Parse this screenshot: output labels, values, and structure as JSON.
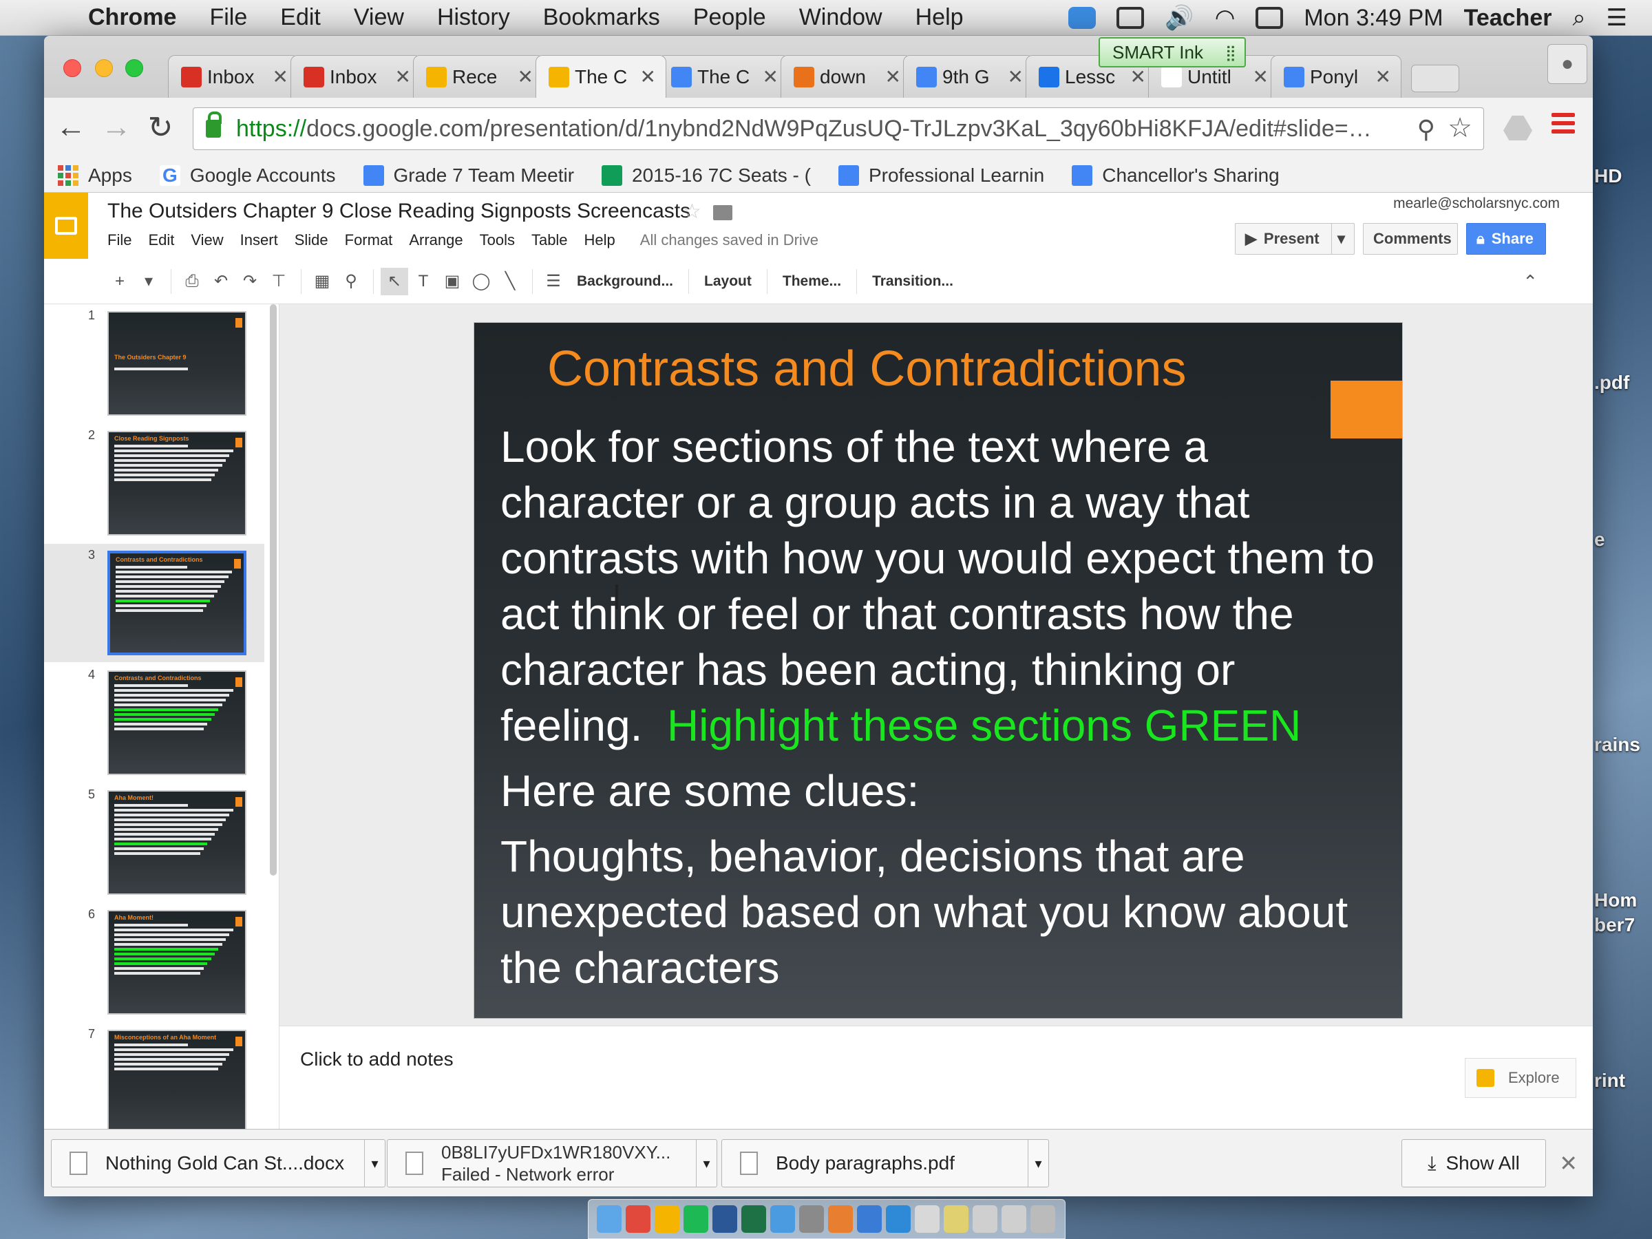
{
  "menubar": {
    "app": "Chrome",
    "items": [
      "File",
      "Edit",
      "View",
      "History",
      "Bookmarks",
      "People",
      "Window",
      "Help"
    ],
    "clock": "Mon 3:49 PM",
    "user": "Teacher"
  },
  "smart_ink": {
    "label": "SMART Ink"
  },
  "tabs": [
    {
      "title": "Inbox",
      "icon": "gmail-icon",
      "color": "#d93025"
    },
    {
      "title": "Inbox",
      "icon": "gmail-icon",
      "color": "#d93025"
    },
    {
      "title": "Rece",
      "icon": "drive-icon",
      "color": "#f4b400"
    },
    {
      "title": "The C",
      "icon": "slides-icon",
      "color": "#f4b400",
      "active": true
    },
    {
      "title": "The C",
      "icon": "docs-icon",
      "color": "#4285f4"
    },
    {
      "title": "down",
      "icon": "download-site-icon",
      "color": "#e8711a"
    },
    {
      "title": "9th G",
      "icon": "docs-icon",
      "color": "#4285f4"
    },
    {
      "title": "Lessc",
      "icon": "lesson-icon",
      "color": "#1a73e8"
    },
    {
      "title": "Untitl",
      "icon": "blank-page-icon",
      "color": "#ffffff"
    },
    {
      "title": "Ponyl",
      "icon": "google-icon",
      "color": "#4285f4"
    }
  ],
  "address": {
    "scheme": "https://",
    "rest": "docs.google.com/presentation/d/1nybnd2NdW9PqZusUQ-TrJLzpv3KaL_3qy60bHi8KFJA/edit#slide=…"
  },
  "bookmarks": [
    {
      "label": "Apps",
      "icon": "apps-grid-icon"
    },
    {
      "label": "Google Accounts",
      "icon": "google-icon"
    },
    {
      "label": "Grade 7 Team Meetir",
      "icon": "docs-icon"
    },
    {
      "label": "2015-16 7C Seats - (",
      "icon": "sheets-icon"
    },
    {
      "label": "Professional Learnin",
      "icon": "docs-icon"
    },
    {
      "label": "Chancellor's Sharing",
      "icon": "docs-icon"
    }
  ],
  "doc": {
    "title": "The Outsiders Chapter 9 Close Reading Signposts Screencasts",
    "menus": [
      "File",
      "Edit",
      "View",
      "Insert",
      "Slide",
      "Format",
      "Arrange",
      "Tools",
      "Table",
      "Help"
    ],
    "saved_status": "All changes saved in Drive",
    "user_email": "mearle@scholarsnyc.com",
    "present_label": "Present",
    "comments_label": "Comments",
    "share_label": "Share"
  },
  "toolbar": {
    "background_label": "Background...",
    "layout_label": "Layout",
    "theme_label": "Theme...",
    "transition_label": "Transition..."
  },
  "slides": [
    {
      "num": "1",
      "title": "The Outsiders Chapter 9",
      "lines": 1,
      "green": 0
    },
    {
      "num": "2",
      "title": "Close Reading Signposts",
      "lines": 8,
      "green": 0
    },
    {
      "num": "3",
      "title": "Contrasts and Contradictions",
      "lines": 10,
      "green": 1,
      "selected": true
    },
    {
      "num": "4",
      "title": "Contrasts and Contradictions",
      "lines": 10,
      "green": 3
    },
    {
      "num": "5",
      "title": "Aha Moment!",
      "lines": 11,
      "green": 1
    },
    {
      "num": "6",
      "title": "Aha Moment!",
      "lines": 11,
      "green": 4
    },
    {
      "num": "7",
      "title": "Misconceptions of an Aha Moment",
      "lines": 6,
      "green": 0
    }
  ],
  "current_slide": {
    "title": "Contrasts and Contradictions",
    "body_1": "Look for sections of the text where a character or a group acts in a way that contrasts with how you would expect them to act think or feel or that contrasts how the character has been acting, thinking or feeling.",
    "highlight": "Highlight these sections GREEN",
    "body_2": "Here are some clues:",
    "body_3": "Thoughts, behavior, decisions that are unexpected based on what you know about the characters",
    "title_color": "#f58a1f",
    "highlight_color": "#19e61e"
  },
  "notes": {
    "placeholder": "Click to add notes",
    "explore_label": "Explore"
  },
  "downloads": [
    {
      "name": "Nothing Gold Can St....docx",
      "status": ""
    },
    {
      "name": "0B8LI7yUFDx1WR180VXY...",
      "status": "Failed - Network error"
    },
    {
      "name": "Body paragraphs.pdf",
      "status": ""
    }
  ],
  "show_all_label": "Show All",
  "desktop_labels": [
    "HD",
    ".pdf",
    "e",
    "rains",
    "Hom",
    "ber7",
    "rint"
  ]
}
